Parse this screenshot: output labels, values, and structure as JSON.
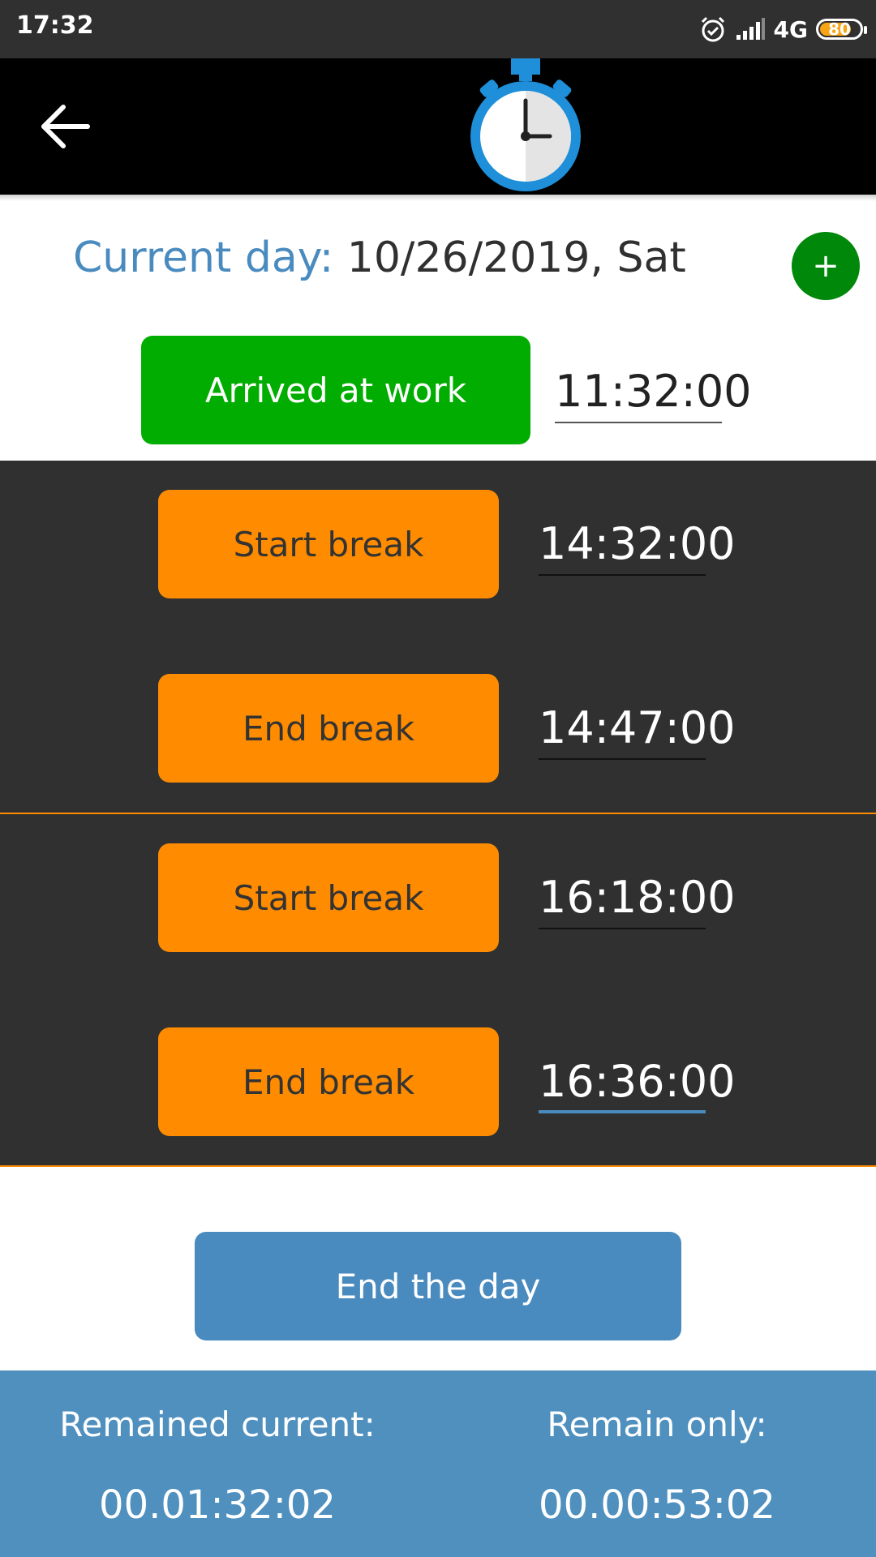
{
  "status_bar": {
    "time": "17:32",
    "network": "4G",
    "battery": "80",
    "battery_fraction": 0.8,
    "icons": [
      "alarm-icon",
      "signal-icon",
      "battery-icon"
    ]
  },
  "app_bar": {
    "back_icon": "arrow-left-icon",
    "logo_icon": "stopwatch-icon"
  },
  "current_day": {
    "label": "Current day:",
    "value": "10/26/2019, Sat"
  },
  "add_button": {
    "label": "+"
  },
  "arrival": {
    "label": "Arrived at work",
    "time": "11:32:00"
  },
  "breaks": [
    {
      "start_label": "Start break",
      "start_time": "14:32:00",
      "end_label": "End break",
      "end_time": "14:47:00"
    },
    {
      "start_label": "Start break",
      "start_time": "16:18:00",
      "end_label": "End break",
      "end_time": "16:36:00"
    }
  ],
  "end_day": {
    "label": "End the day"
  },
  "footer": {
    "remained_current_label": "Remained current:",
    "remained_current_value": "00.01:32:02",
    "remain_only_label": "Remain only:",
    "remain_only_value": "00.00:53:02"
  },
  "colors": {
    "green": "#00ad00",
    "orange": "#ff8c00",
    "blue": "#4a8bbf",
    "dark": "#303030"
  }
}
